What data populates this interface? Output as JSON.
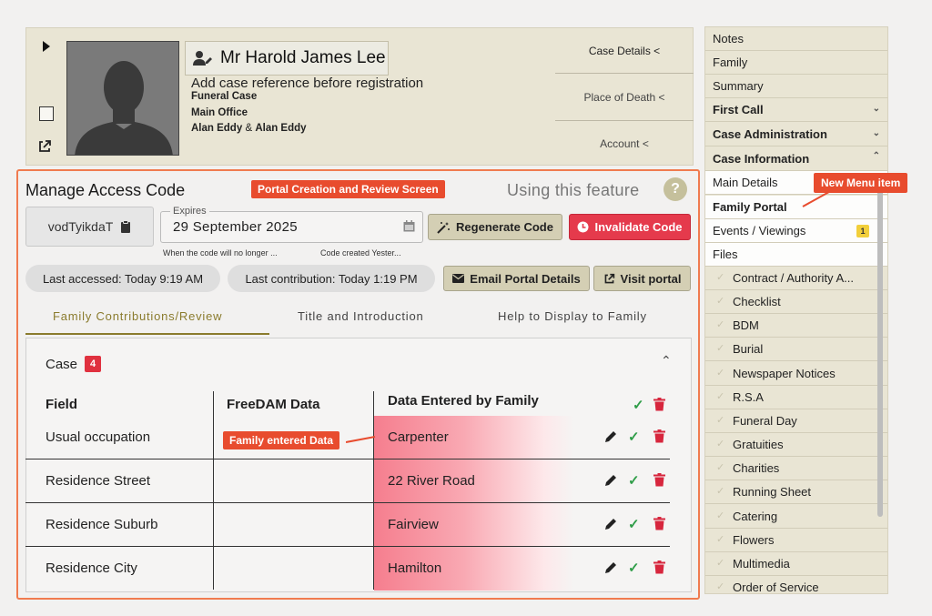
{
  "header": {
    "name": "Mr Harold James Lee",
    "case_ref_prompt": "Add case reference before registration",
    "case_type": "Funeral Case",
    "office": "Main Office",
    "arranger1": "Alan Eddy",
    "amp": "&",
    "arranger2": "Alan Eddy",
    "nav": [
      "Case Details <",
      "Place of Death <",
      "Account <"
    ]
  },
  "sidebar": {
    "items": [
      {
        "label": "Notes"
      },
      {
        "label": "Family"
      },
      {
        "label": "Summary"
      },
      {
        "label": "First Call"
      },
      {
        "label": "Case Administration"
      },
      {
        "label": "Case Information"
      },
      {
        "label": "Main Details"
      },
      {
        "label": "Family Portal"
      },
      {
        "label": "Events / Viewings",
        "badge": "1"
      },
      {
        "label": "Files"
      },
      {
        "label": "Contract / Authority A..."
      },
      {
        "label": "Checklist"
      },
      {
        "label": "BDM"
      },
      {
        "label": "Burial"
      },
      {
        "label": "Newspaper Notices"
      },
      {
        "label": "R.S.A"
      },
      {
        "label": "Funeral Day"
      },
      {
        "label": "Gratuities"
      },
      {
        "label": "Charities"
      },
      {
        "label": "Running Sheet"
      },
      {
        "label": "Catering"
      },
      {
        "label": "Flowers"
      },
      {
        "label": "Multimedia"
      },
      {
        "label": "Order of Service"
      }
    ]
  },
  "annotations": {
    "portal_screen": "Portal Creation and Review Screen",
    "new_menu_item": "New Menu item",
    "family_entered": "Family entered Data"
  },
  "access": {
    "title": "Manage Access Code",
    "help_text": "Using this feature",
    "help_icon": "?",
    "code": "vodTyikdaT",
    "expires_label": "Expires",
    "expires_value": "29 September 2025",
    "hint1": "When the code will no longer ...",
    "hint2": "Code created Yester...",
    "regenerate": "Regenerate Code",
    "invalidate": "Invalidate Code",
    "last_accessed": "Last accessed:  Today 9:19 AM",
    "last_contribution": "Last contribution:  Today 1:19 PM",
    "email_btn": "Email Portal Details",
    "visit_btn": "Visit portal"
  },
  "tabs": [
    "Family Contributions/Review",
    "Title and Introduction",
    "Help to Display to Family"
  ],
  "table": {
    "section": "Case",
    "count": "4",
    "headers": [
      "Field",
      "FreeDAM Data",
      "Data Entered by Family"
    ],
    "rows": [
      {
        "field": "Usual occupation",
        "freedam": "",
        "family": "Carpenter"
      },
      {
        "field": "Residence Street",
        "freedam": "",
        "family": "22 River Road"
      },
      {
        "field": "Residence Suburb",
        "freedam": "",
        "family": "Fairview"
      },
      {
        "field": "Residence City",
        "freedam": "",
        "family": "Hamilton"
      }
    ]
  },
  "colors": {
    "accent_red": "#e53a4c",
    "annotation": "#e84c2e",
    "olive": "#8a7b2d",
    "check_green": "#2f9d48"
  }
}
